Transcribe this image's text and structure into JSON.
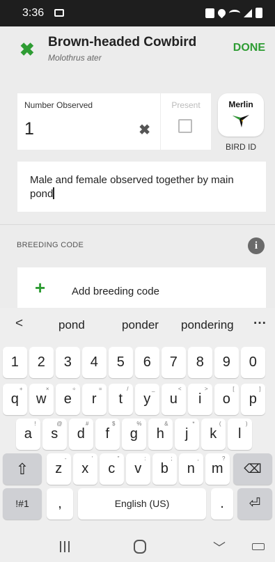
{
  "status_bar": {
    "time": "3:36"
  },
  "header": {
    "title": "Brown-headed Cowbird",
    "subtitle": "Molothrus ater",
    "done_label": "DONE",
    "close_icon": "close-x-icon"
  },
  "count": {
    "label": "Number Observed",
    "value": "1",
    "present_label": "Present",
    "present_checked": false
  },
  "merlin": {
    "logo_text": "Merlin",
    "bird_id_label": "BIRD ID"
  },
  "comment": {
    "text": "Male and female observed together by main pond"
  },
  "breeding": {
    "header": "BREEDING CODE",
    "add_label": "Add breeding code"
  },
  "keyboard": {
    "suggestions": [
      "pond",
      "ponder",
      "pondering"
    ],
    "row_numbers": [
      "1",
      "2",
      "3",
      "4",
      "5",
      "6",
      "7",
      "8",
      "9",
      "0"
    ],
    "row1": [
      {
        "k": "q",
        "s": "+"
      },
      {
        "k": "w",
        "s": "×"
      },
      {
        "k": "e",
        "s": "÷"
      },
      {
        "k": "r",
        "s": "="
      },
      {
        "k": "t",
        "s": "/"
      },
      {
        "k": "y",
        "s": "_"
      },
      {
        "k": "u",
        "s": "<"
      },
      {
        "k": "i",
        "s": ">"
      },
      {
        "k": "o",
        "s": "["
      },
      {
        "k": "p",
        "s": "]"
      }
    ],
    "row2": [
      {
        "k": "a",
        "s": "!"
      },
      {
        "k": "s",
        "s": "@"
      },
      {
        "k": "d",
        "s": "#"
      },
      {
        "k": "f",
        "s": "$"
      },
      {
        "k": "g",
        "s": "%"
      },
      {
        "k": "h",
        "s": "&"
      },
      {
        "k": "j",
        "s": "*"
      },
      {
        "k": "k",
        "s": "("
      },
      {
        "k": "l",
        "s": ")"
      }
    ],
    "row3": [
      {
        "k": "z",
        "s": "-"
      },
      {
        "k": "x",
        "s": "'"
      },
      {
        "k": "c",
        "s": "\""
      },
      {
        "k": "v",
        "s": ":"
      },
      {
        "k": "b",
        "s": ";"
      },
      {
        "k": "n",
        "s": ","
      },
      {
        "k": "m",
        "s": "?"
      }
    ],
    "symbols_label": "!#1",
    "comma": ",",
    "space_label": "English (US)",
    "period": "."
  }
}
